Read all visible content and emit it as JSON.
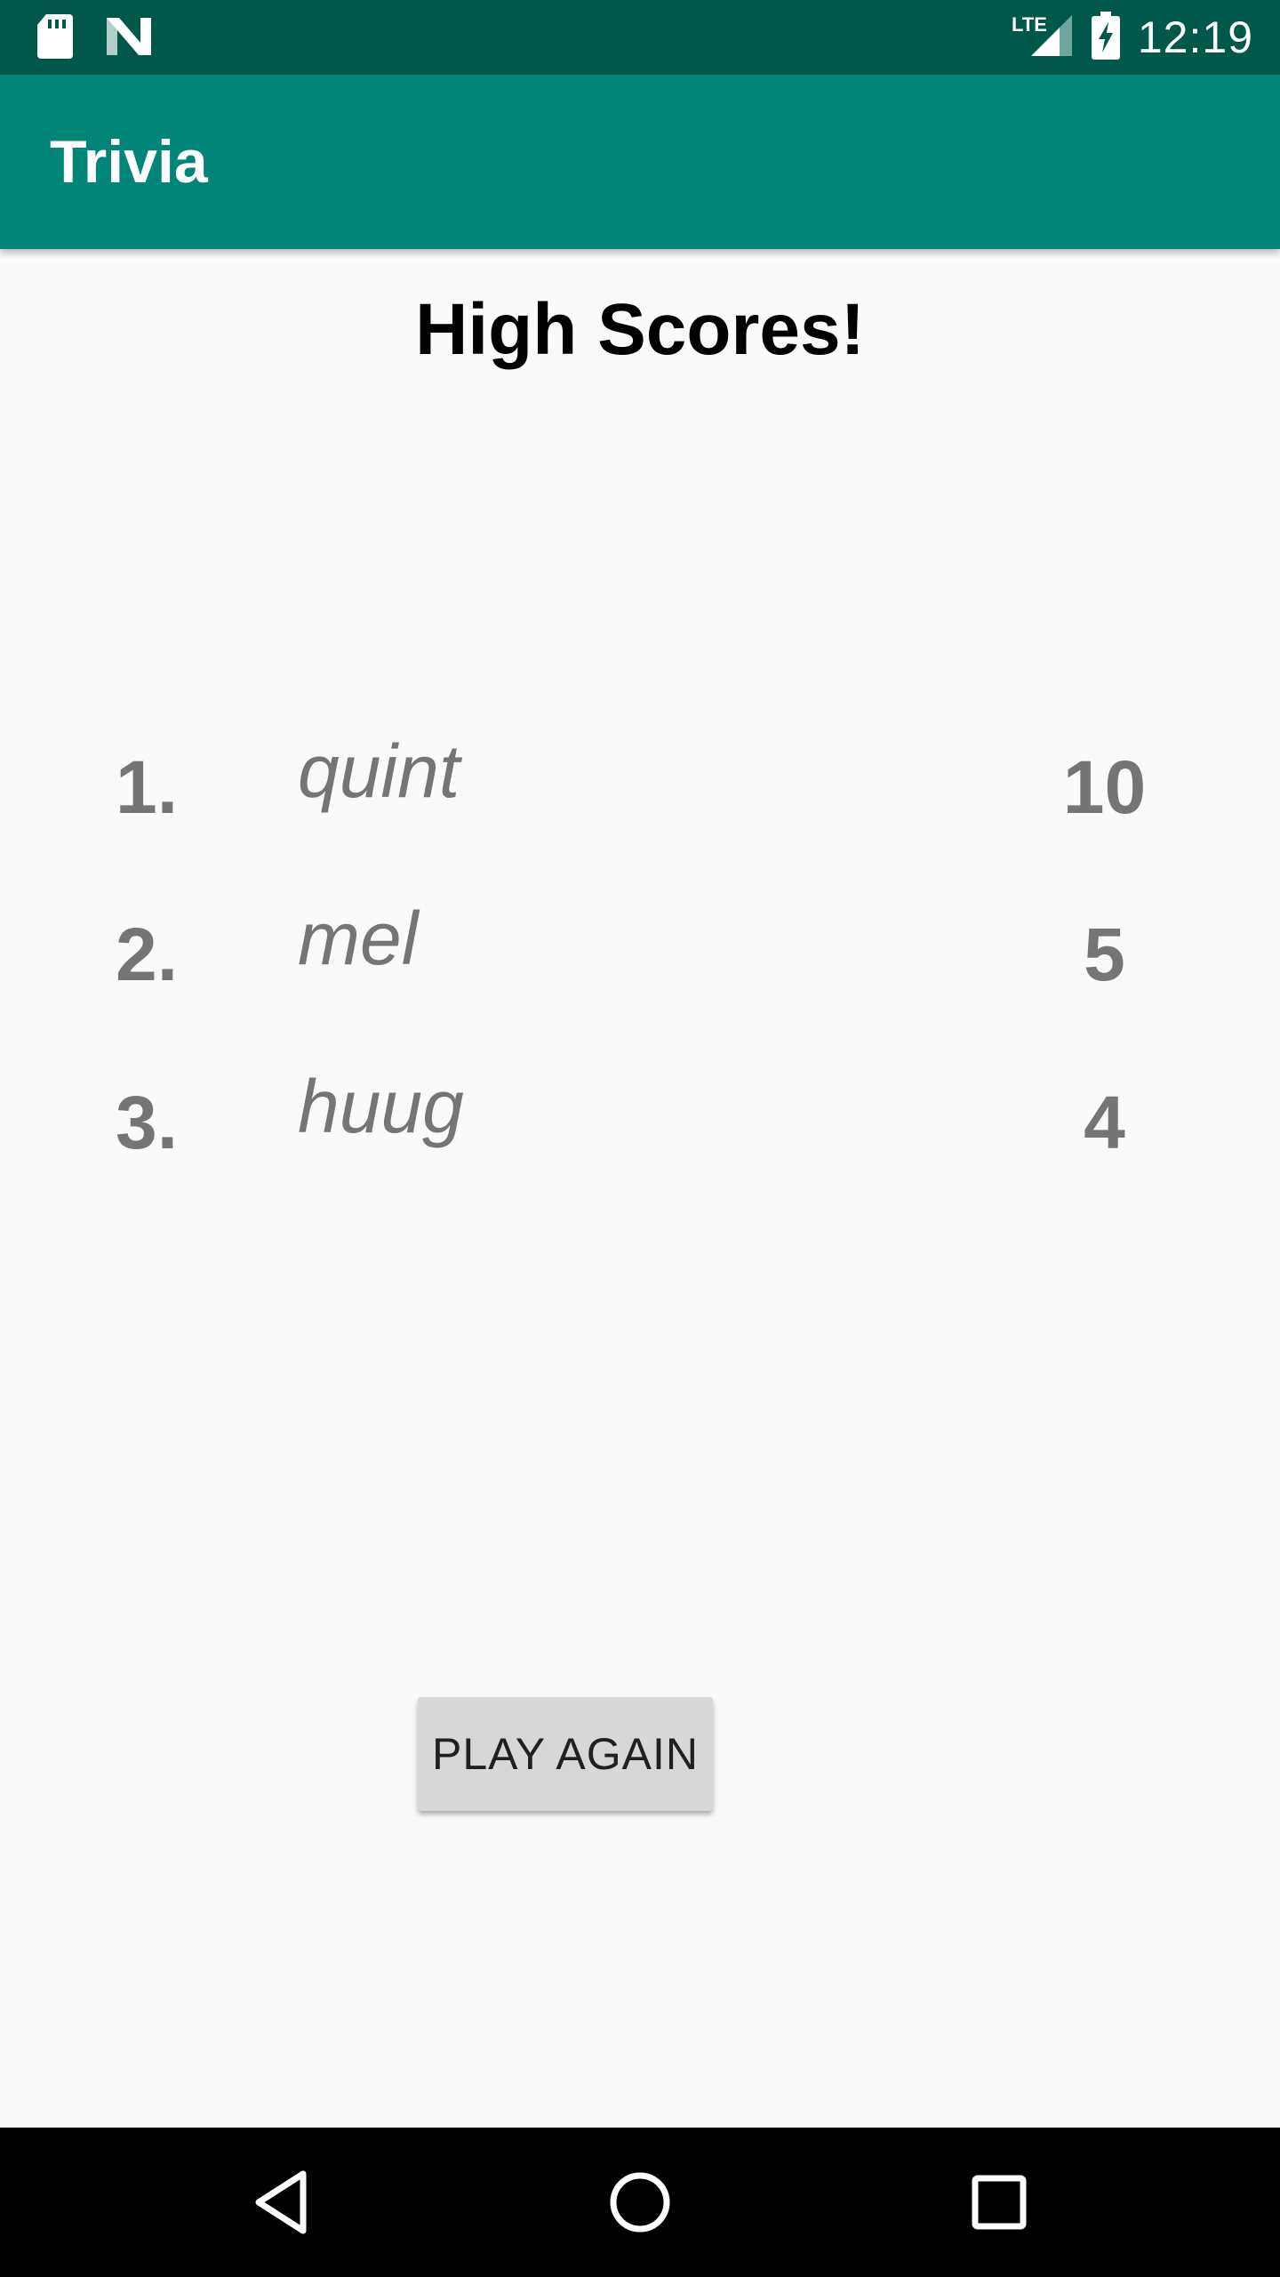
{
  "status_bar": {
    "time": "12:19",
    "network_label": "LTE",
    "icons": [
      "sd-card-icon",
      "n-notification-icon",
      "signal-icon",
      "battery-charging-icon"
    ]
  },
  "app_bar": {
    "title": "Trivia"
  },
  "main": {
    "title": "High Scores!",
    "scores": [
      {
        "rank": "1.",
        "name": "quint",
        "score": "10"
      },
      {
        "rank": "2.",
        "name": "mel",
        "score": "5"
      },
      {
        "rank": "3.",
        "name": "huug",
        "score": "4"
      }
    ],
    "play_again_label": "PLAY AGAIN"
  },
  "nav_bar": {
    "icons": [
      "back-icon",
      "home-icon",
      "recents-icon"
    ]
  },
  "colors": {
    "status_bar": "#00584b",
    "app_bar": "#008577",
    "background": "#fafafa",
    "score_text": "#757575",
    "button": "#d6d7d7"
  }
}
